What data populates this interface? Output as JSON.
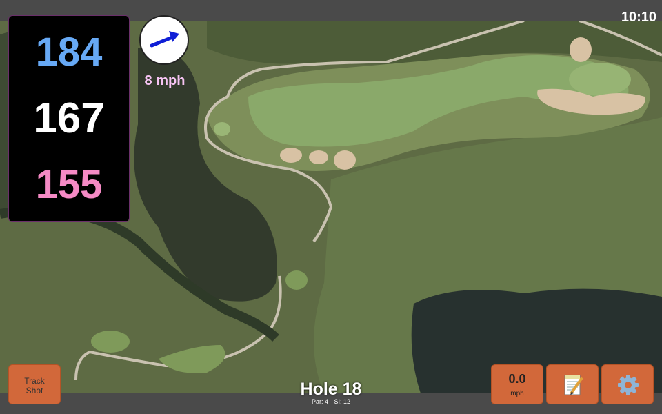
{
  "status": {
    "clock": "10:10"
  },
  "distances": {
    "back": "184",
    "middle": "167",
    "front": "155"
  },
  "colors": {
    "back": "#67a9f5",
    "middle": "#ffffff",
    "front": "#f58ac5",
    "button": "#d2683a",
    "wind_arrow": "#0f1fd6"
  },
  "wind": {
    "speed_label": "8 mph",
    "direction_icon": "arrow-icon"
  },
  "hole": {
    "title": "Hole 18",
    "par_label": "Par: 4",
    "si_label": "SI: 12"
  },
  "buttons": {
    "track_line1": "Track",
    "track_line2": "Shot",
    "speed_value": "0.0",
    "speed_unit": "mph",
    "notes_icon": "notepad-icon",
    "settings_icon": "gear-icon"
  }
}
